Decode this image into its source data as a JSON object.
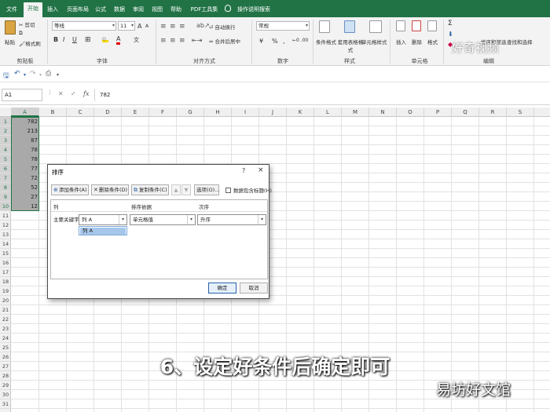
{
  "tabs": [
    "文件",
    "开始",
    "插入",
    "页面布局",
    "公式",
    "数据",
    "审阅",
    "视图",
    "帮助",
    "PDF工具集"
  ],
  "active_tab": "开始",
  "tell_me": "操作说明搜索",
  "ribbon": {
    "clipboard": {
      "paste": "粘贴",
      "cut": "剪切",
      "format_painter": "格式刷",
      "label": "剪贴板"
    },
    "font": {
      "name": "等线",
      "size": "11",
      "bold": "B",
      "italic": "I",
      "underline": "U",
      "grow": "A",
      "shrink": "A",
      "wen": "文",
      "color_a": "A",
      "label": "字体"
    },
    "alignment": {
      "wrap": "自动换行",
      "merge": "合并后居中",
      "label": "对齐方式"
    },
    "number": {
      "format": "常规",
      "currency": "¥",
      "percent": "%",
      "comma": ",",
      "label": "数字"
    },
    "styles": {
      "conditional": "条件格式",
      "table": "套用表格格式",
      "cell_styles": "单元格样式",
      "label": "样式"
    },
    "cells": {
      "insert": "插入",
      "delete": "删除",
      "format": "格式",
      "label": "单元格"
    },
    "editing": {
      "sort_filter": "排序和筛选",
      "find_select": "查找和选择",
      "label": "编辑"
    }
  },
  "watermark_top": "好奇视频",
  "formula": {
    "namebox": "A1",
    "fx": "fx",
    "value": "782"
  },
  "columns": [
    "A",
    "B",
    "C",
    "D",
    "E",
    "F",
    "G",
    "H",
    "I",
    "J",
    "K",
    "L",
    "M",
    "N",
    "O",
    "P",
    "Q",
    "R",
    "S"
  ],
  "rows": [
    "1",
    "2",
    "3",
    "4",
    "5",
    "6",
    "7",
    "8",
    "9",
    "10",
    "11",
    "12",
    "13",
    "14",
    "15",
    "16",
    "17",
    "18",
    "19",
    "20",
    "21",
    "22",
    "23",
    "24",
    "25",
    "26",
    "27",
    "28",
    "29",
    "30",
    "31"
  ],
  "column_a_values": [
    "782",
    "213",
    "87",
    "78",
    "78",
    "77",
    "72",
    "52",
    "27",
    "12"
  ],
  "dialog": {
    "title": "排序",
    "help": "?",
    "close": "×",
    "add_level": "添加条件(A)",
    "delete_level": "删除条件(D)",
    "copy_level": "复制条件(C)",
    "up": "▲",
    "down": "▼",
    "options": "选项(O)...",
    "has_header": "数据包含标题(H)",
    "header_column": "列",
    "header_sort_on": "排序依据",
    "header_order": "次序",
    "row_label": "主要关键字",
    "column_value": "列 A",
    "sort_on_value": "单元格值",
    "order_value": "升序",
    "dropdown_option": "列 A",
    "ok": "确定",
    "cancel": "取消"
  },
  "subtitle": "6、设定好条件后确定即可",
  "watermark_bottom": "易坊好文馆"
}
